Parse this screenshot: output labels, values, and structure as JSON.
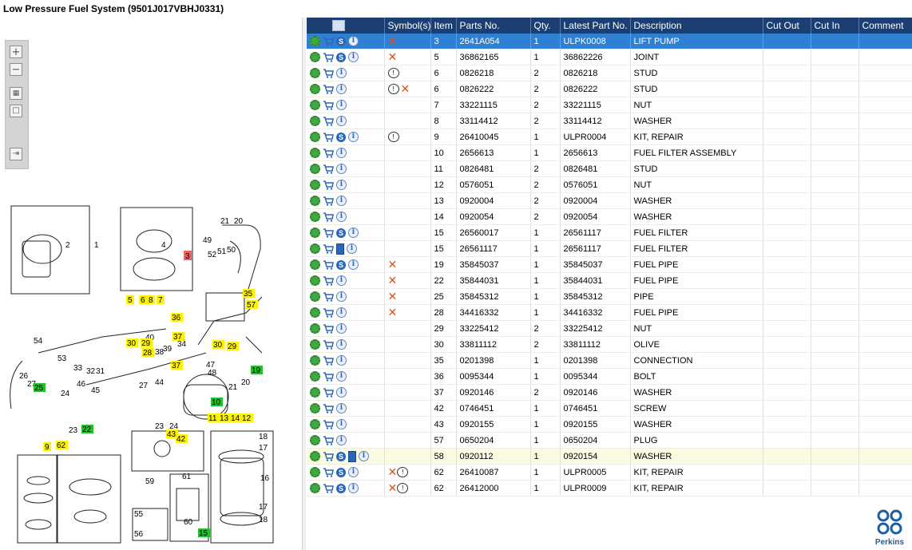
{
  "title": "Low Pressure Fuel System (9501J017VBHJ0331)",
  "columns": [
    "",
    "Symbol(s)",
    "Item",
    "Parts No.",
    "Qty.",
    "Latest Part No.",
    "Description",
    "Cut Out",
    "Cut In",
    "Comment"
  ],
  "rows": [
    {
      "icons": [
        "gear",
        "cart",
        "s",
        "i"
      ],
      "syms": [
        "x"
      ],
      "item": "3",
      "part": "2641A054",
      "qty": "1",
      "latest": "ULPK0008",
      "desc": "LIFT PUMP",
      "state": "sel"
    },
    {
      "icons": [
        "gear",
        "cart",
        "s",
        "i"
      ],
      "syms": [
        "x"
      ],
      "item": "5",
      "part": "36862165",
      "qty": "1",
      "latest": "36862226",
      "desc": "JOINT",
      "state": ""
    },
    {
      "icons": [
        "gear",
        "cart",
        "i"
      ],
      "syms": [
        "note"
      ],
      "item": "6",
      "part": "0826218",
      "qty": "2",
      "latest": "0826218",
      "desc": "STUD",
      "state": ""
    },
    {
      "icons": [
        "gear",
        "cart",
        "i"
      ],
      "syms": [
        "note",
        "x"
      ],
      "item": "6",
      "part": "0826222",
      "qty": "2",
      "latest": "0826222",
      "desc": "STUD",
      "state": ""
    },
    {
      "icons": [
        "gear",
        "cart",
        "i"
      ],
      "syms": [],
      "item": "7",
      "part": "33221115",
      "qty": "2",
      "latest": "33221115",
      "desc": "NUT",
      "state": ""
    },
    {
      "icons": [
        "gear",
        "cart",
        "i"
      ],
      "syms": [],
      "item": "8",
      "part": "33114412",
      "qty": "2",
      "latest": "33114412",
      "desc": "WASHER",
      "state": ""
    },
    {
      "icons": [
        "gear",
        "cart",
        "s",
        "i"
      ],
      "syms": [
        "note"
      ],
      "item": "9",
      "part": "26410045",
      "qty": "1",
      "latest": "ULPR0004",
      "desc": "KIT, REPAIR",
      "state": ""
    },
    {
      "icons": [
        "gear",
        "cart",
        "i"
      ],
      "syms": [],
      "item": "10",
      "part": "2656613",
      "qty": "1",
      "latest": "2656613",
      "desc": "FUEL FILTER ASSEMBLY",
      "state": ""
    },
    {
      "icons": [
        "gear",
        "cart",
        "i"
      ],
      "syms": [],
      "item": "11",
      "part": "0826481",
      "qty": "2",
      "latest": "0826481",
      "desc": "STUD",
      "state": ""
    },
    {
      "icons": [
        "gear",
        "cart",
        "i"
      ],
      "syms": [],
      "item": "12",
      "part": "0576051",
      "qty": "2",
      "latest": "0576051",
      "desc": "NUT",
      "state": ""
    },
    {
      "icons": [
        "gear",
        "cart",
        "i"
      ],
      "syms": [],
      "item": "13",
      "part": "0920004",
      "qty": "2",
      "latest": "0920004",
      "desc": "WASHER",
      "state": ""
    },
    {
      "icons": [
        "gear",
        "cart",
        "i"
      ],
      "syms": [],
      "item": "14",
      "part": "0920054",
      "qty": "2",
      "latest": "0920054",
      "desc": "WASHER",
      "state": ""
    },
    {
      "icons": [
        "gear",
        "cart",
        "s",
        "i"
      ],
      "syms": [],
      "item": "15",
      "part": "26560017",
      "qty": "1",
      "latest": "26561117",
      "desc": "FUEL FILTER",
      "state": ""
    },
    {
      "icons": [
        "gear",
        "cart",
        "book",
        "i"
      ],
      "syms": [],
      "item": "15",
      "part": "26561117",
      "qty": "1",
      "latest": "26561117",
      "desc": "FUEL FILTER",
      "state": ""
    },
    {
      "icons": [
        "gear",
        "cart",
        "s",
        "i"
      ],
      "syms": [
        "x"
      ],
      "item": "19",
      "part": "35845037",
      "qty": "1",
      "latest": "35845037",
      "desc": "FUEL PIPE",
      "state": ""
    },
    {
      "icons": [
        "gear",
        "cart",
        "i"
      ],
      "syms": [
        "x"
      ],
      "item": "22",
      "part": "35844031",
      "qty": "1",
      "latest": "35844031",
      "desc": "FUEL PIPE",
      "state": ""
    },
    {
      "icons": [
        "gear",
        "cart",
        "i"
      ],
      "syms": [
        "x"
      ],
      "item": "25",
      "part": "35845312",
      "qty": "1",
      "latest": "35845312",
      "desc": "PIPE",
      "state": ""
    },
    {
      "icons": [
        "gear",
        "cart",
        "i"
      ],
      "syms": [
        "x"
      ],
      "item": "28",
      "part": "34416332",
      "qty": "1",
      "latest": "34416332",
      "desc": "FUEL PIPE",
      "state": ""
    },
    {
      "icons": [
        "gear",
        "cart",
        "i"
      ],
      "syms": [],
      "item": "29",
      "part": "33225412",
      "qty": "2",
      "latest": "33225412",
      "desc": "NUT",
      "state": ""
    },
    {
      "icons": [
        "gear",
        "cart",
        "i"
      ],
      "syms": [],
      "item": "30",
      "part": "33811112",
      "qty": "2",
      "latest": "33811112",
      "desc": "OLIVE",
      "state": ""
    },
    {
      "icons": [
        "gear",
        "cart",
        "i"
      ],
      "syms": [],
      "item": "35",
      "part": "0201398",
      "qty": "1",
      "latest": "0201398",
      "desc": "CONNECTION",
      "state": ""
    },
    {
      "icons": [
        "gear",
        "cart",
        "i"
      ],
      "syms": [],
      "item": "36",
      "part": "0095344",
      "qty": "1",
      "latest": "0095344",
      "desc": "BOLT",
      "state": ""
    },
    {
      "icons": [
        "gear",
        "cart",
        "i"
      ],
      "syms": [],
      "item": "37",
      "part": "0920146",
      "qty": "2",
      "latest": "0920146",
      "desc": "WASHER",
      "state": ""
    },
    {
      "icons": [
        "gear",
        "cart",
        "i"
      ],
      "syms": [],
      "item": "42",
      "part": "0746451",
      "qty": "1",
      "latest": "0746451",
      "desc": "SCREW",
      "state": ""
    },
    {
      "icons": [
        "gear",
        "cart",
        "i"
      ],
      "syms": [],
      "item": "43",
      "part": "0920155",
      "qty": "1",
      "latest": "0920155",
      "desc": "WASHER",
      "state": ""
    },
    {
      "icons": [
        "gear",
        "cart",
        "i"
      ],
      "syms": [],
      "item": "57",
      "part": "0650204",
      "qty": "1",
      "latest": "0650204",
      "desc": "PLUG",
      "state": ""
    },
    {
      "icons": [
        "gear",
        "cart",
        "s",
        "book",
        "i"
      ],
      "syms": [],
      "item": "58",
      "part": "0920112",
      "qty": "1",
      "latest": "0920154",
      "desc": "WASHER",
      "state": "hl"
    },
    {
      "icons": [
        "gear",
        "cart",
        "s",
        "i"
      ],
      "syms": [
        "x",
        "note"
      ],
      "item": "62",
      "part": "26410087",
      "qty": "1",
      "latest": "ULPR0005",
      "desc": "KIT, REPAIR",
      "state": ""
    },
    {
      "icons": [
        "gear",
        "cart",
        "s",
        "i"
      ],
      "syms": [
        "x",
        "note"
      ],
      "item": "62",
      "part": "26412000",
      "qty": "1",
      "latest": "ULPR0009",
      "desc": "KIT, REPAIR",
      "state": ""
    }
  ],
  "diagram_labels": {
    "yellow": [
      "5",
      "6",
      "8",
      "7",
      "35",
      "57",
      "36",
      "37",
      "30",
      "29",
      "28",
      "37",
      "30",
      "29",
      "9",
      "62",
      "43",
      "42",
      "11",
      "13",
      "14",
      "12"
    ],
    "green": [
      "19",
      "25",
      "22",
      "10",
      "15"
    ],
    "red": [
      "3"
    ],
    "plain": [
      "1",
      "2",
      "4",
      "21",
      "20",
      "49",
      "52",
      "51",
      "50",
      "54",
      "53",
      "33",
      "32",
      "31",
      "40",
      "39",
      "38",
      "34",
      "47",
      "48",
      "21",
      "20",
      "26",
      "27",
      "46",
      "45",
      "24",
      "44",
      "27",
      "23",
      "24",
      "23",
      "18",
      "17",
      "16",
      "17",
      "18",
      "59",
      "61",
      "60",
      "55",
      "56"
    ]
  },
  "logo_text": "Perkins"
}
